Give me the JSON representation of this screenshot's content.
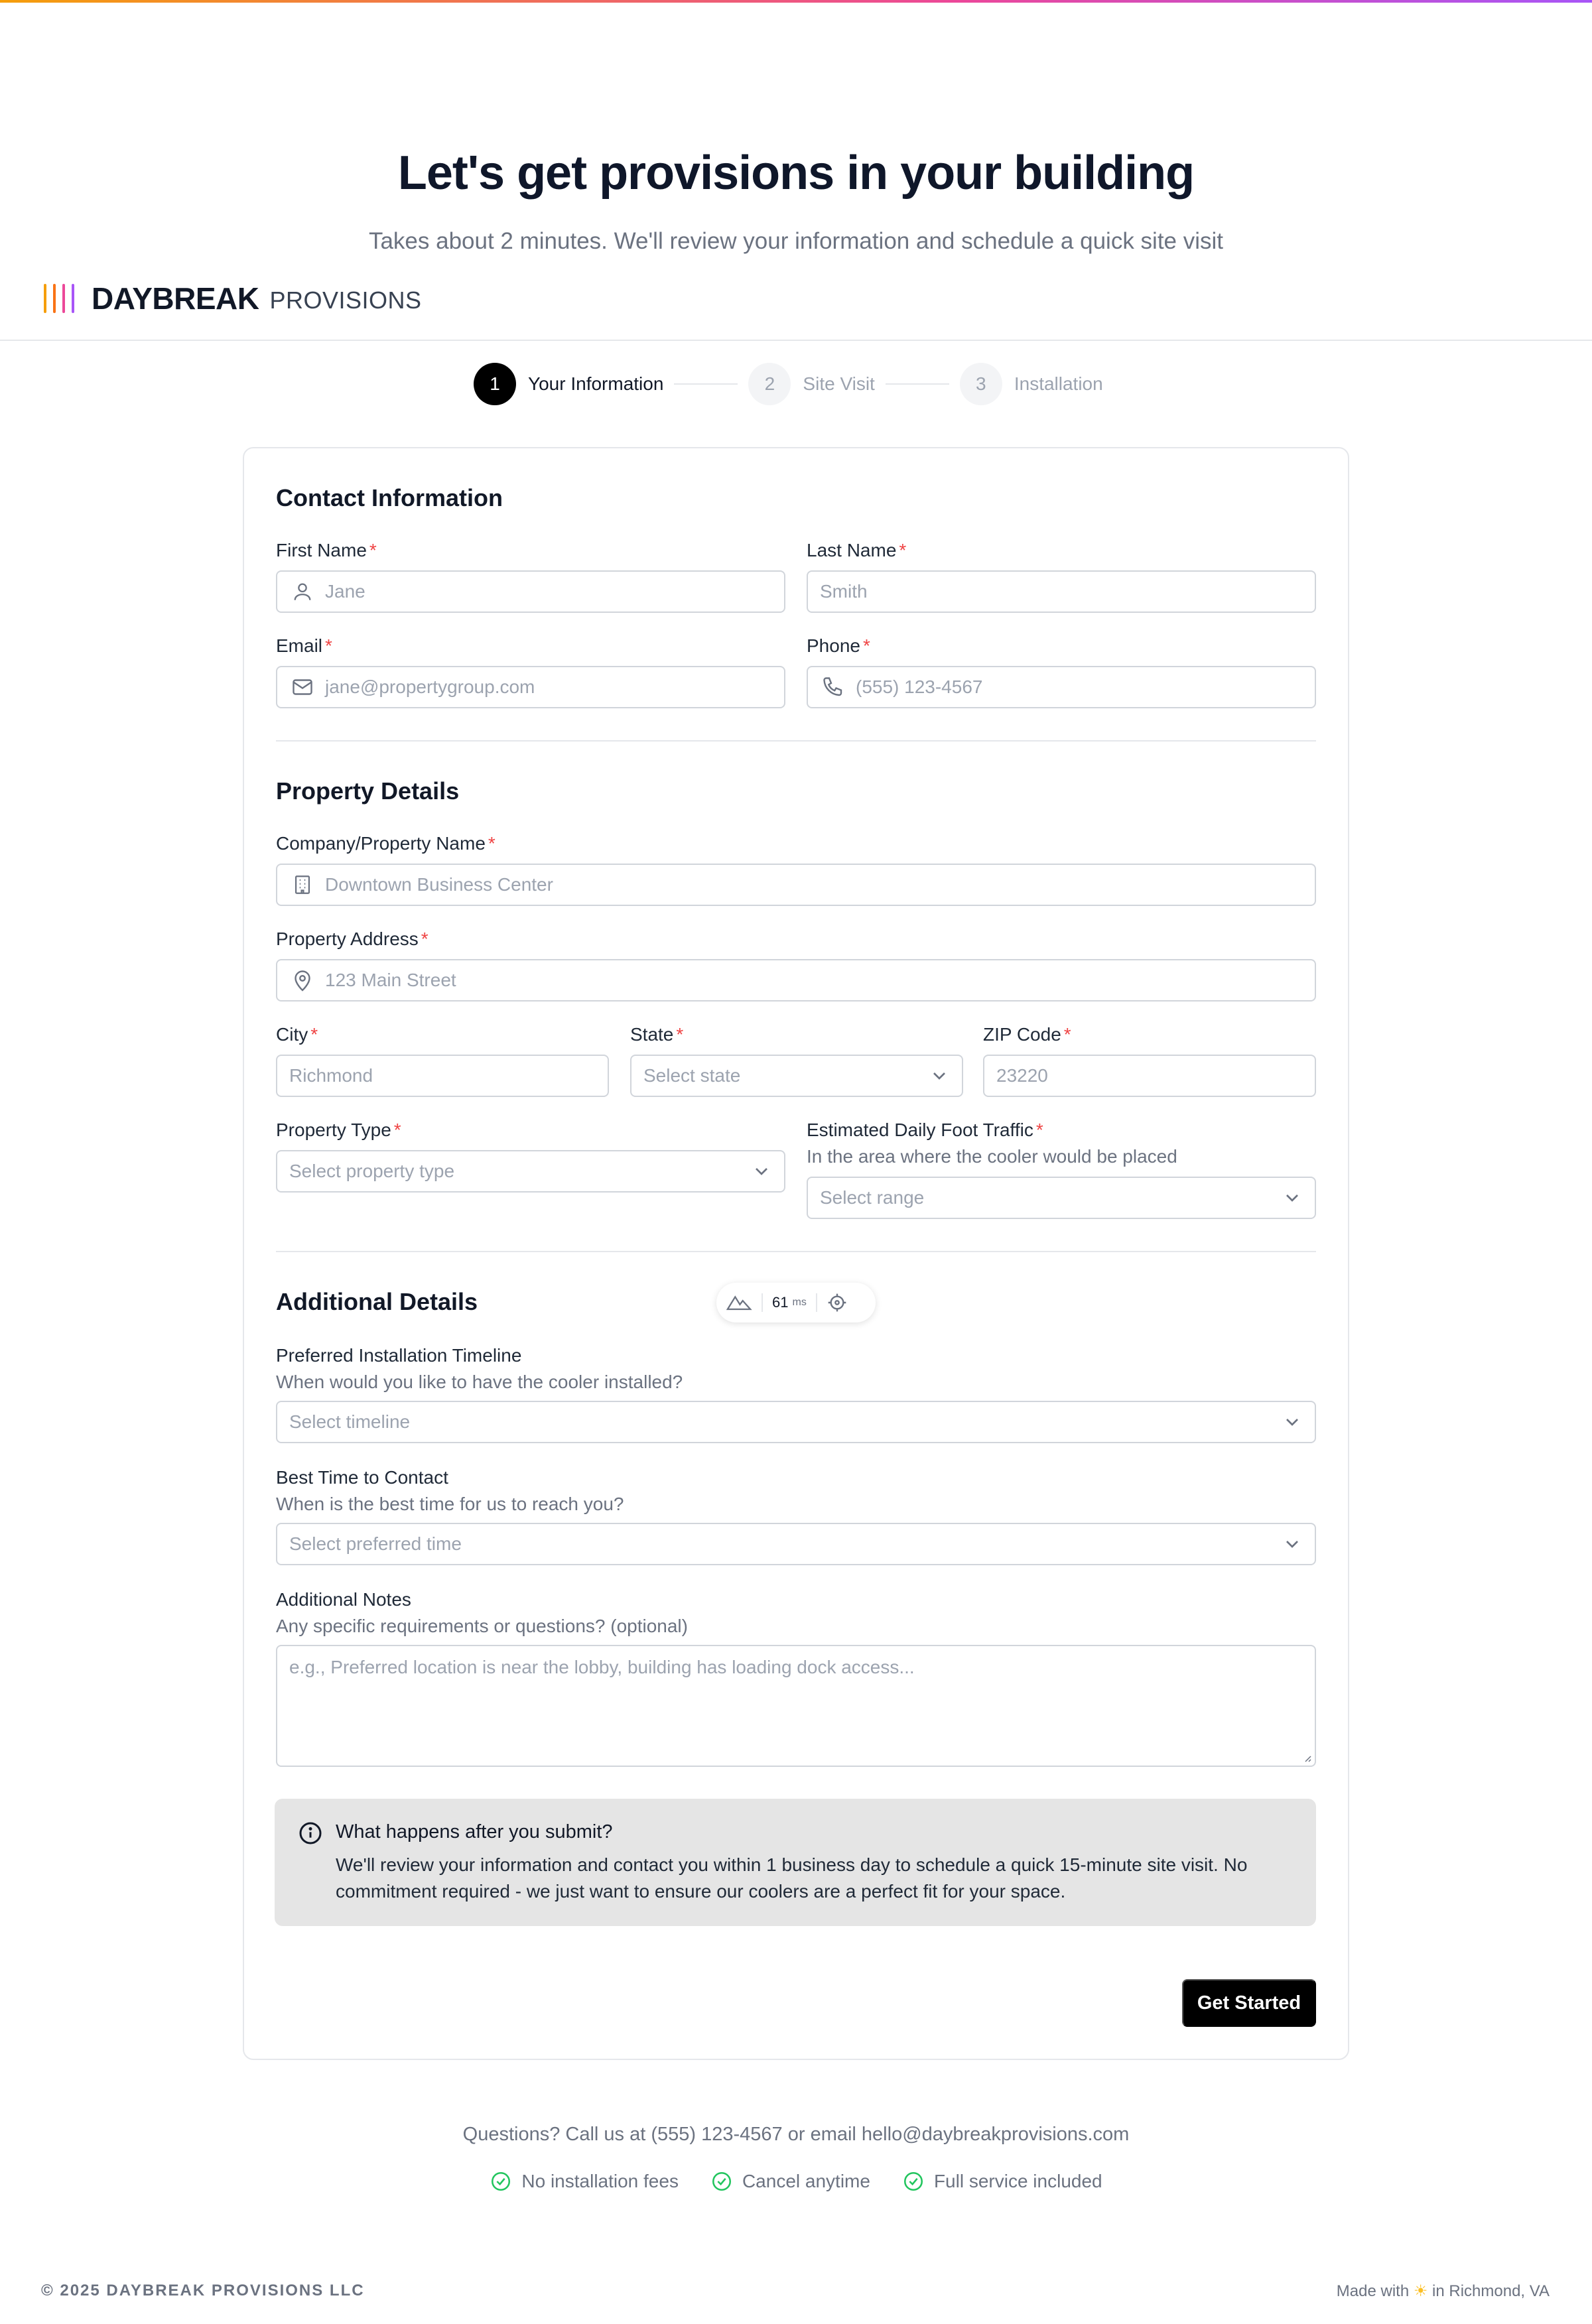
{
  "hero": {
    "title": "Let's get provisions in your building",
    "subtitle": "Takes about 2 minutes. We'll review your information and schedule a quick site visit"
  },
  "brand": {
    "name": "DAYBREAK",
    "sub": "PROVISIONS",
    "bar_colors": [
      "#f59e0b",
      "#f97316",
      "#ec4899",
      "#a855f7"
    ]
  },
  "stepper": {
    "steps": [
      {
        "num": "1",
        "label": "Your Information",
        "active": true
      },
      {
        "num": "2",
        "label": "Site Visit",
        "active": false
      },
      {
        "num": "3",
        "label": "Installation",
        "active": false
      }
    ]
  },
  "contact": {
    "title": "Contact Information",
    "first_name": {
      "label": "First Name",
      "placeholder": "Jane",
      "icon": "user-icon"
    },
    "last_name": {
      "label": "Last Name",
      "placeholder": "Smith"
    },
    "email": {
      "label": "Email",
      "placeholder": "jane@propertygroup.com",
      "icon": "mail-icon"
    },
    "phone": {
      "label": "Phone",
      "placeholder": "(555) 123-4567",
      "icon": "phone-icon"
    }
  },
  "property": {
    "title": "Property Details",
    "company": {
      "label": "Company/Property Name",
      "placeholder": "Downtown Business Center",
      "icon": "building-icon"
    },
    "address": {
      "label": "Property Address",
      "placeholder": "123 Main Street",
      "icon": "map-pin-icon"
    },
    "city": {
      "label": "City",
      "placeholder": "Richmond"
    },
    "state": {
      "label": "State",
      "placeholder": "Select state"
    },
    "zip": {
      "label": "ZIP Code",
      "placeholder": "23220"
    },
    "type": {
      "label": "Property Type",
      "placeholder": "Select property type"
    },
    "traffic": {
      "label": "Estimated Daily Foot Traffic",
      "help": "In the area where the cooler would be placed",
      "placeholder": "Select range"
    }
  },
  "additional": {
    "title": "Additional Details",
    "timeline": {
      "label": "Preferred Installation Timeline",
      "help": "When would you like to have the cooler installed?",
      "placeholder": "Select timeline"
    },
    "contact_time": {
      "label": "Best Time to Contact",
      "help": "When is the best time for us to reach you?",
      "placeholder": "Select preferred time"
    },
    "notes": {
      "label": "Additional Notes",
      "help": "Any specific requirements or questions? (optional)",
      "placeholder": "e.g., Preferred location is near the lobby, building has loading dock access..."
    }
  },
  "required_marker": "*",
  "perf_widget": {
    "value": "61",
    "unit": "ms"
  },
  "info_box": {
    "title": "What happens after you submit?",
    "body": "We'll review your information and contact you within 1 business day to schedule a quick 15-minute site visit. No commitment required - we just want to ensure our coolers are a perfect fit for your space."
  },
  "submit_label": "Get Started",
  "footer": {
    "questions": "Questions? Call us at (555) 123-4567 or email hello@daybreakprovisions.com",
    "badges": [
      "No installation fees",
      "Cancel anytime",
      "Full service included"
    ],
    "copyright": "© 2025 DAYBREAK PROVISIONS LLC",
    "made_prefix": "Made with",
    "made_suffix": "in Richmond, VA"
  },
  "colors": {
    "accent": "#000000",
    "required": "#ef4444",
    "check": "#22c55e",
    "info_bg": "#e5e5e5"
  }
}
